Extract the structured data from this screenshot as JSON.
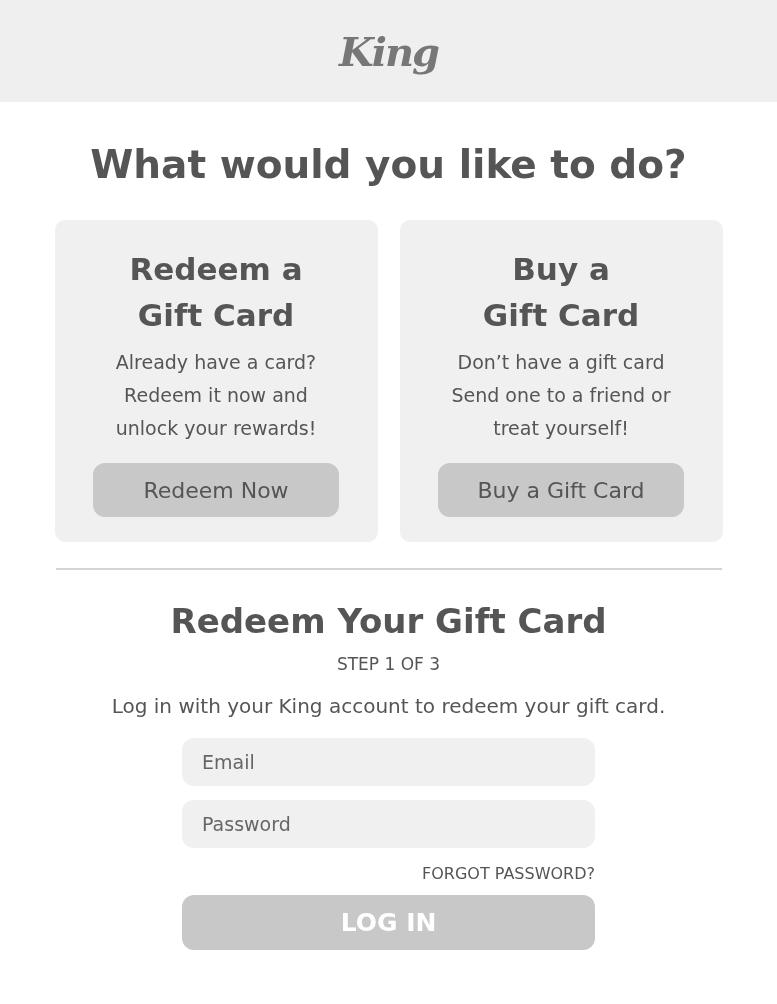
{
  "header": {
    "logo": "King"
  },
  "title": "What would you like to do?",
  "options": [
    {
      "title": "Redeem a Gift Card",
      "description": "Already have a card? Redeem it now and unlock your rewards!",
      "button": "Redeem Now"
    },
    {
      "title": "Buy a Gift Card",
      "description": "Don’t have a gift card Send one to a friend or treat yourself!",
      "button": "Buy a Gift Card"
    }
  ],
  "redeem": {
    "heading": "Redeem Your Gift Card",
    "step": "STEP 1 OF 3",
    "instruction": "Log in with your King account to redeem your gift card.",
    "fields": [
      {
        "placeholder": "Email"
      },
      {
        "placeholder": "Password"
      }
    ],
    "forgot_link": "FORGOT PASSWORD?",
    "login_button": {
      "label": "LOG IN",
      "disabled": true
    }
  }
}
